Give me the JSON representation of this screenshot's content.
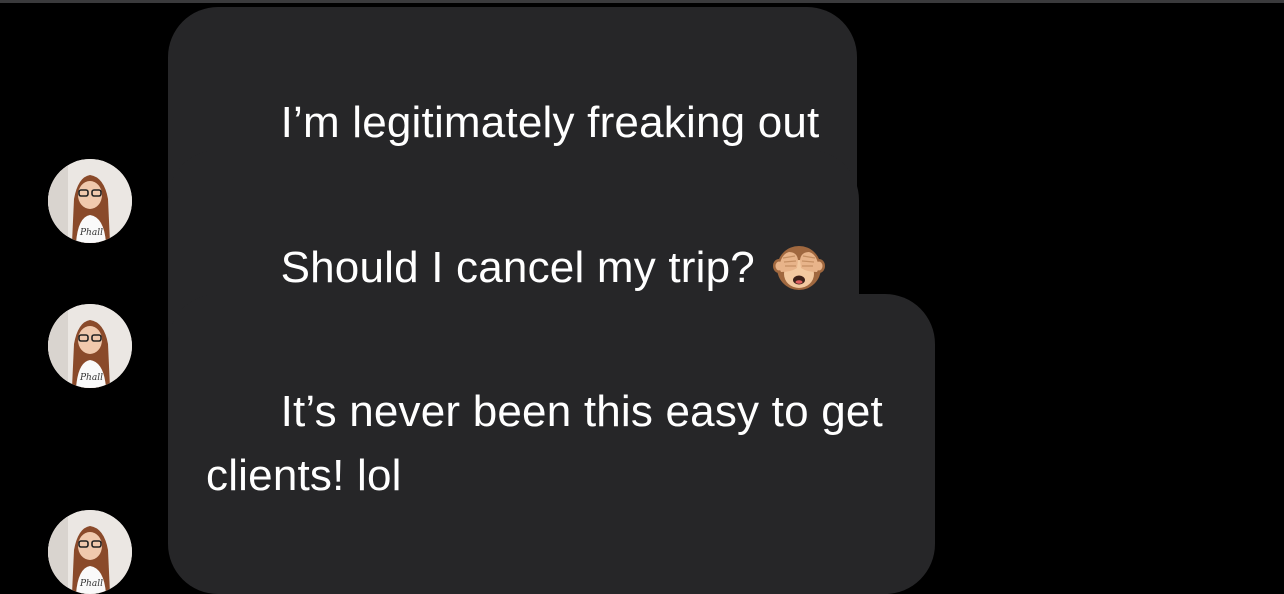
{
  "colors": {
    "background": "#000000",
    "bubble": "#262628",
    "text": "#ffffff"
  },
  "messages": [
    {
      "text": "I’m legitimately freaking out",
      "emoji": null,
      "avatar_icon": "sender-avatar"
    },
    {
      "text": "Should I cancel my trip?",
      "emoji": "see-no-evil-monkey-icon",
      "avatar_icon": "sender-avatar"
    },
    {
      "text": "It’s never been this easy to get\nclients! lol",
      "emoji": null,
      "avatar_icon": "sender-avatar"
    }
  ]
}
